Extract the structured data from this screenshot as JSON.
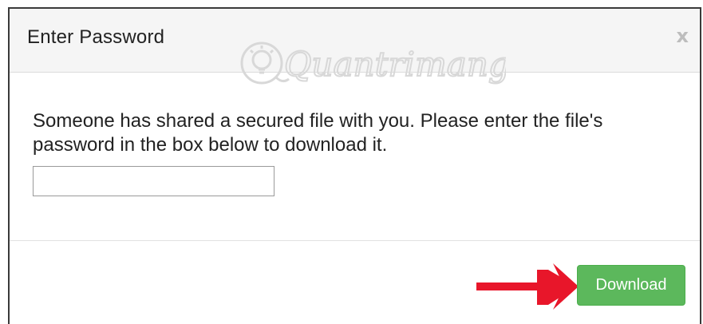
{
  "dialog": {
    "title": "Enter Password",
    "close_label": "x",
    "message": "Someone has shared a secured file with you. Please enter the file's password in the box below to download it.",
    "password_value": "",
    "password_placeholder": "",
    "download_label": "Download"
  },
  "watermark": {
    "text": "Quantrimang"
  },
  "colors": {
    "header_bg": "#f5f5f5",
    "download_button": "#5cb85c",
    "arrow": "#e8162a",
    "watermark": "#d8d8d8"
  },
  "icons": {
    "close": "close-icon",
    "annotation_arrow": "arrow-right-icon",
    "watermark_logo": "lightbulb-logo"
  }
}
